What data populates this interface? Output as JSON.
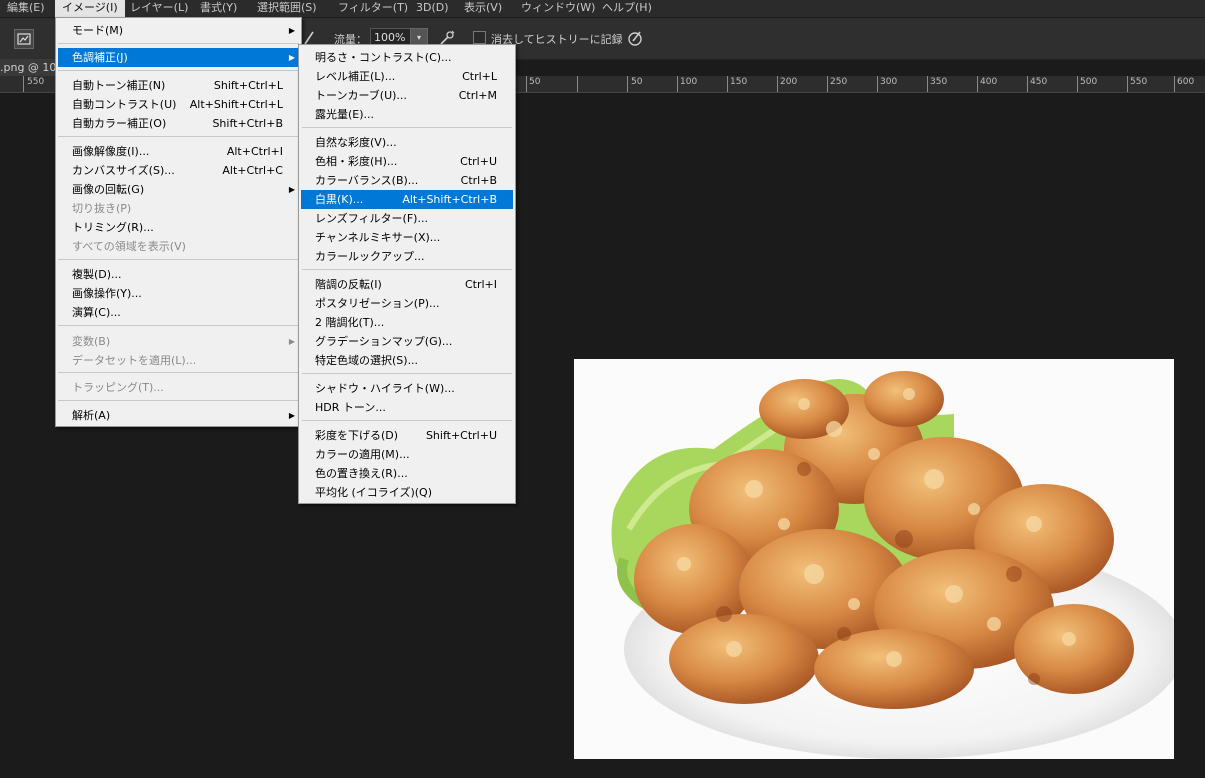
{
  "menubar": {
    "items": [
      "編集(E)",
      "イメージ(I)",
      "レイヤー(L)",
      "書式(Y)",
      "選択範囲(S)",
      "フィルター(T)",
      "3D(D)",
      "表示(V)",
      "ウィンドウ(W)",
      "ヘルプ(H)"
    ]
  },
  "options": {
    "flow_label": "流量：",
    "flow_value": "100%",
    "erase_history_label": "消去してヒストリーに記録"
  },
  "document_tab": {
    "title": ".png @ 10"
  },
  "ruler": {
    "labels": [
      "550",
      "50",
      "50",
      "100",
      "150",
      "200",
      "250",
      "300",
      "350",
      "400",
      "450",
      "500",
      "550",
      "600"
    ]
  },
  "image_menu": {
    "items": [
      {
        "label": "モード(M)",
        "shortcut": "",
        "submenu": true
      },
      {
        "label": "色調補正(J)",
        "shortcut": "",
        "submenu": true,
        "highlighted": true
      },
      {
        "label": "自動トーン補正(N)",
        "shortcut": "Shift+Ctrl+L"
      },
      {
        "label": "自動コントラスト(U)",
        "shortcut": "Alt+Shift+Ctrl+L"
      },
      {
        "label": "自動カラー補正(O)",
        "shortcut": "Shift+Ctrl+B"
      },
      {
        "label": "画像解像度(I)...",
        "shortcut": "Alt+Ctrl+I"
      },
      {
        "label": "カンバスサイズ(S)...",
        "shortcut": "Alt+Ctrl+C"
      },
      {
        "label": "画像の回転(G)",
        "shortcut": "",
        "submenu": true
      },
      {
        "label": "切り抜き(P)",
        "shortcut": "",
        "disabled": true
      },
      {
        "label": "トリミング(R)...",
        "shortcut": ""
      },
      {
        "label": "すべての領域を表示(V)",
        "shortcut": "",
        "disabled": true
      },
      {
        "label": "複製(D)...",
        "shortcut": ""
      },
      {
        "label": "画像操作(Y)...",
        "shortcut": ""
      },
      {
        "label": "演算(C)...",
        "shortcut": ""
      },
      {
        "label": "変数(B)",
        "shortcut": "",
        "submenu": true,
        "disabled": true
      },
      {
        "label": "データセットを適用(L)...",
        "shortcut": "",
        "disabled": true
      },
      {
        "label": "トラッピング(T)...",
        "shortcut": "",
        "disabled": true
      },
      {
        "label": "解析(A)",
        "shortcut": "",
        "submenu": true
      }
    ]
  },
  "adjust_menu": {
    "items": [
      {
        "label": "明るさ・コントラスト(C)...",
        "shortcut": ""
      },
      {
        "label": "レベル補正(L)...",
        "shortcut": "Ctrl+L"
      },
      {
        "label": "トーンカーブ(U)...",
        "shortcut": "Ctrl+M"
      },
      {
        "label": "露光量(E)...",
        "shortcut": ""
      },
      {
        "label": "自然な彩度(V)...",
        "shortcut": ""
      },
      {
        "label": "色相・彩度(H)...",
        "shortcut": "Ctrl+U"
      },
      {
        "label": "カラーバランス(B)...",
        "shortcut": "Ctrl+B"
      },
      {
        "label": "白黒(K)...",
        "shortcut": "Alt+Shift+Ctrl+B",
        "highlighted": true
      },
      {
        "label": "レンズフィルター(F)...",
        "shortcut": ""
      },
      {
        "label": "チャンネルミキサー(X)...",
        "shortcut": ""
      },
      {
        "label": "カラールックアップ...",
        "shortcut": ""
      },
      {
        "label": "階調の反転(I)",
        "shortcut": "Ctrl+I"
      },
      {
        "label": "ポスタリゼーション(P)...",
        "shortcut": ""
      },
      {
        "label": "2 階調化(T)...",
        "shortcut": ""
      },
      {
        "label": "グラデーションマップ(G)...",
        "shortcut": ""
      },
      {
        "label": "特定色域の選択(S)...",
        "shortcut": ""
      },
      {
        "label": "シャドウ・ハイライト(W)...",
        "shortcut": ""
      },
      {
        "label": "HDR トーン...",
        "shortcut": ""
      },
      {
        "label": "彩度を下げる(D)",
        "shortcut": "Shift+Ctrl+U"
      },
      {
        "label": "カラーの適用(M)...",
        "shortcut": ""
      },
      {
        "label": "色の置き換え(R)...",
        "shortcut": ""
      },
      {
        "label": "平均化 (イコライズ)(Q)",
        "shortcut": ""
      }
    ]
  },
  "colors": {
    "highlight": "#0078d7",
    "menu_bg": "#f0f0f0",
    "canvas_bg": "#1b1b1b"
  }
}
